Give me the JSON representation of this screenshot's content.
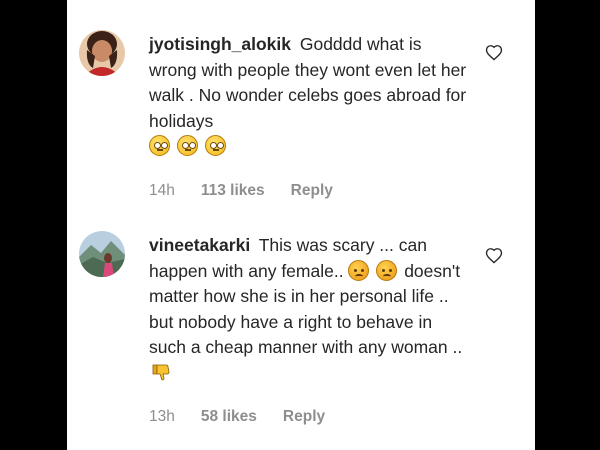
{
  "comments": [
    {
      "username": "jyotisingh_alokik",
      "text": "Godddd what is wrong with people they wont even let her walk . No wonder celebs goes abroad for holidays",
      "emojis": [
        "face-with-rolling-eyes",
        "face-with-rolling-eyes",
        "face-with-rolling-eyes"
      ],
      "time": "14h",
      "likes": "113 likes",
      "reply": "Reply"
    },
    {
      "username": "vineetakarki",
      "text_part1": "This was scary ... can happen with any female..",
      "emojis_inline": [
        "angry-face",
        "angry-face"
      ],
      "text_part2": "doesn't matter how she is in her personal life .. but nobody have a right to behave in such a cheap manner with any woman ..",
      "trailing_icon": "thumbs-down",
      "time": "13h",
      "likes": "58 likes",
      "reply": "Reply"
    }
  ],
  "colors": {
    "background": "#000000",
    "panel": "#ffffff",
    "text": "#262626",
    "muted": "#8e8e8e"
  }
}
